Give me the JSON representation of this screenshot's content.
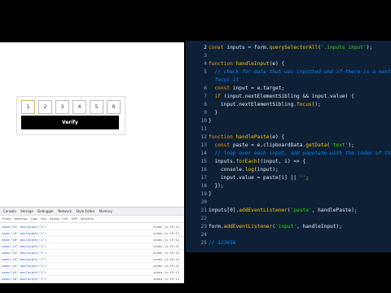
{
  "browser": {
    "otp_digits": [
      "1",
      "2",
      "3",
      "4",
      "5",
      "6"
    ],
    "verify_label": "Verify"
  },
  "devtools": {
    "tabs": [
      "Console",
      "Storage",
      "Debugger",
      "Network",
      "Style Editor",
      "Memory"
    ],
    "filter_items": [
      "Errors",
      "Warnings",
      "Logs",
      "Info",
      "Debug",
      "CSS",
      "XHR",
      "Requests"
    ],
    "log_lines": [
      {
        "text": "name=\"n4\" maxlength=\"1\">",
        "source": "index.js:19:12"
      },
      {
        "text": "name=\"n5\" maxlength=\"1\">",
        "source": "index.js:19:12"
      },
      {
        "text": "name=\"n6\" maxlength=\"1\">",
        "source": "index.js:19:12"
      },
      {
        "text": "name=\"n1\" maxlength=\"1\">",
        "source": "index.js:19:12"
      },
      {
        "text": "name=\"n2\" maxlength=\"1\">",
        "source": "index.js:19:12"
      },
      {
        "text": "name=\"n3\" maxlength=\"1\">",
        "source": "index.js:19:12"
      },
      {
        "text": "name=\"n4\" maxlength=\"1\">",
        "source": "index.js:19:12"
      },
      {
        "text": "name=\"n5\" maxlength=\"1\">",
        "source": "index.js:19:12"
      },
      {
        "text": "name=\"n6\" maxlength=\"1\">",
        "source": "index.js:19:12"
      }
    ]
  },
  "editor": {
    "lines": [
      {
        "n": "2",
        "parts": [
          [
            "kw",
            "const "
          ],
          [
            "",
            "inputs = form."
          ],
          [
            "fn",
            "querySelectorAll"
          ],
          [
            "",
            "("
          ],
          [
            "str",
            "'.inputs input'"
          ],
          [
            "",
            ");"
          ]
        ]
      },
      {
        "n": "3",
        "parts": []
      },
      {
        "n": "4",
        "parts": [
          [
            "kw",
            "function "
          ],
          [
            "fn",
            "handleInput"
          ],
          [
            "",
            "(e) {"
          ]
        ]
      },
      {
        "n": "5",
        "parts": [
          [
            "cm",
            "  // check for data that was inputted and if there is a next"
          ]
        ]
      },
      {
        "n": "",
        "parts": [
          [
            "cm",
            "  focus it"
          ]
        ]
      },
      {
        "n": "6",
        "parts": [
          [
            "kw",
            "  const "
          ],
          [
            "",
            "input = e.target;"
          ]
        ]
      },
      {
        "n": "7",
        "parts": [
          [
            "kw",
            "  if "
          ],
          [
            "",
            "(input.nextElementSibling && input.value) {"
          ]
        ]
      },
      {
        "n": "8",
        "parts": [
          [
            "",
            "    input.nextElementSibling."
          ],
          [
            "fn",
            "focus"
          ],
          [
            "",
            "();"
          ]
        ]
      },
      {
        "n": "9",
        "parts": [
          [
            "",
            "  }"
          ]
        ]
      },
      {
        "n": "10",
        "parts": [
          [
            "",
            "}"
          ]
        ]
      },
      {
        "n": "11",
        "parts": []
      },
      {
        "n": "12",
        "parts": [
          [
            "kw",
            "function "
          ],
          [
            "fn",
            "handlePaste"
          ],
          [
            "",
            "(e) {"
          ]
        ]
      },
      {
        "n": "13",
        "parts": [
          [
            "kw",
            "  const "
          ],
          [
            "",
            "paste = e.clipboardData."
          ],
          [
            "fn",
            "getData"
          ],
          [
            "",
            "("
          ],
          [
            "str",
            "'text'"
          ],
          [
            "",
            ");"
          ]
        ]
      },
      {
        "n": "14",
        "parts": [
          [
            "cm",
            "  // loop over each input, and populate with the index of tha"
          ]
        ]
      },
      {
        "n": "15",
        "parts": [
          [
            "",
            "  inputs."
          ],
          [
            "fn",
            "forEach"
          ],
          [
            "",
            "((input, i) => {"
          ]
        ]
      },
      {
        "n": "16",
        "parts": [
          [
            "",
            "    console."
          ],
          [
            "fn",
            "log"
          ],
          [
            "",
            "(input);"
          ]
        ]
      },
      {
        "n": "17",
        "parts": [
          [
            "",
            "    input.value = paste[i] || "
          ],
          [
            "str",
            "''"
          ],
          [
            "",
            ";"
          ]
        ]
      },
      {
        "n": "18",
        "parts": [
          [
            "",
            "  });"
          ]
        ]
      },
      {
        "n": "19",
        "parts": [
          [
            "",
            "}"
          ]
        ]
      },
      {
        "n": "20",
        "parts": []
      },
      {
        "n": "21",
        "parts": [
          [
            "",
            "inputs[0]."
          ],
          [
            "fn",
            "addEventListener"
          ],
          [
            "",
            "("
          ],
          [
            "str",
            "'paste'"
          ],
          [
            "",
            ", handlePaste);"
          ]
        ]
      },
      {
        "n": "22",
        "parts": []
      },
      {
        "n": "23",
        "parts": [
          [
            "",
            "form."
          ],
          [
            "fn",
            "addEventListener"
          ],
          [
            "",
            "("
          ],
          [
            "str",
            "'input'"
          ],
          [
            "",
            ", handleInput);"
          ]
        ]
      },
      {
        "n": "24",
        "parts": []
      },
      {
        "n": "25",
        "parts": [
          [
            "cm",
            "// 123456"
          ]
        ]
      }
    ]
  }
}
